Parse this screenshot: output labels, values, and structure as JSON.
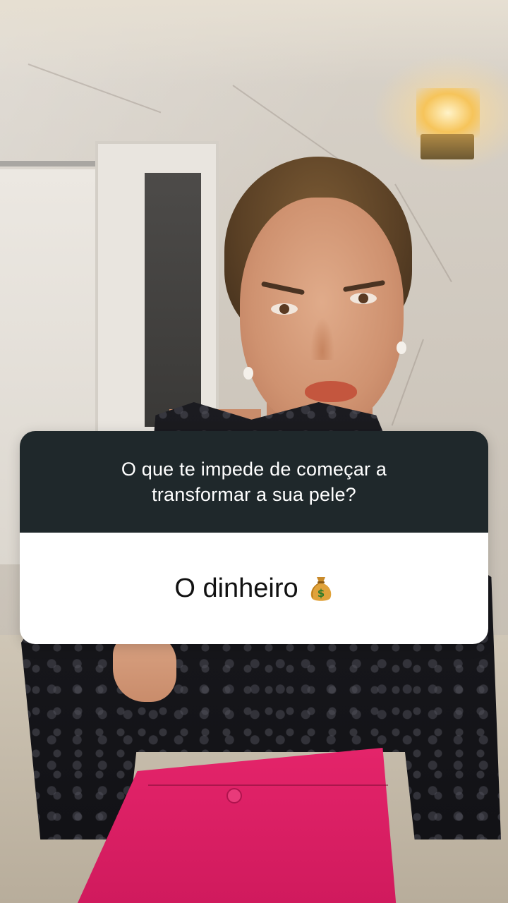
{
  "question_sticker": {
    "question": "O que te impede de começar a transformar a sua pele?",
    "answer": "O dinheiro",
    "answer_emoji_icon": "money-bag-icon",
    "header_color": "#1f282b",
    "body_color": "#ffffff"
  },
  "scene": {
    "pants_color": "#e4246a",
    "top_color": "#121216"
  }
}
